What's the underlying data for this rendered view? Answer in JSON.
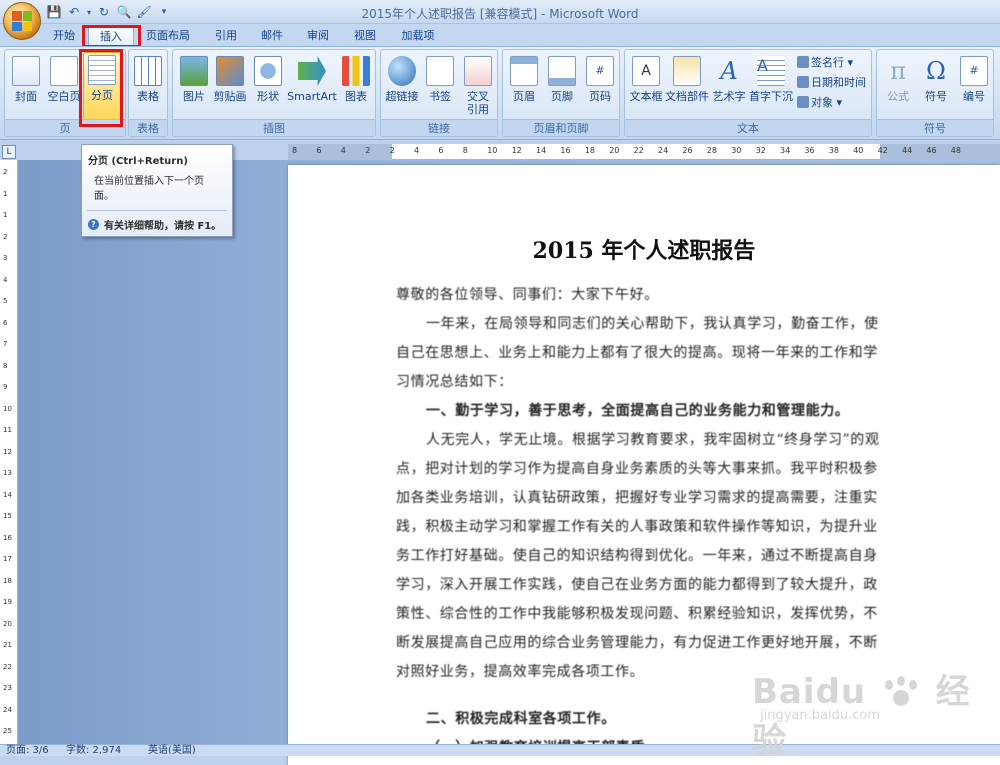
{
  "window": {
    "title": "2015年个人述职报告 [兼容模式] - Microsoft Word"
  },
  "tabs": [
    "开始",
    "插入",
    "页面布局",
    "引用",
    "邮件",
    "审阅",
    "视图",
    "加载项"
  ],
  "active_tab": "插入",
  "groups": {
    "page": {
      "label": "页",
      "buttons": [
        "封面",
        "空白页",
        "分页"
      ]
    },
    "table": {
      "label": "表格",
      "buttons": [
        "表格"
      ]
    },
    "illustrations": {
      "label": "插图",
      "buttons": [
        "图片",
        "剪贴画",
        "形状",
        "SmartArt",
        "图表"
      ]
    },
    "links": {
      "label": "链接",
      "buttons": [
        "超链接",
        "书签",
        "交叉引用"
      ]
    },
    "header_footer": {
      "label": "页眉和页脚",
      "buttons": [
        "页眉",
        "页脚",
        "页码"
      ]
    },
    "text": {
      "label": "文本",
      "buttons": [
        "文本框",
        "文档部件",
        "艺术字",
        "首字下沉"
      ],
      "small": [
        "签名行",
        "日期和时间",
        "对象"
      ]
    },
    "symbols": {
      "label": "符号",
      "buttons": [
        "公式",
        "符号",
        "编号"
      ]
    }
  },
  "tooltip": {
    "title": "分页 (Ctrl+Return)",
    "body": "在当前位置插入下一个页面。",
    "help": "有关详细帮助，请按 F1。"
  },
  "document": {
    "title": "2015 年个人述职报告",
    "paragraphs": [
      {
        "text": "尊敬的各位领导、同事们：大家下午好。",
        "bold": false,
        "indent": false
      },
      {
        "text": "一年来，在局领导和同志们的关心帮助下，我认真学习，勤奋工作，使自己在思想上、业务上和能力上都有了很大的提高。现将一年来的工作和学习情况总结如下：",
        "bold": false,
        "indent": true
      },
      {
        "text": "一、勤于学习，善于思考，全面提高自己的业务能力和管理能力。",
        "bold": true,
        "indent": true
      },
      {
        "text": "人无完人，学无止境。根据学习教育要求，我牢固树立“终身学习”的观点，把对计划的学习作为提高自身业务素质的头等大事来抓。我平时积极参加各类业务培训，认真钻研政策，把握好专业学习需求的提高需要，注重实践，积极主动学习和掌握工作有关的人事政策和软件操作等知识，为提升业务工作打好基础。使自己的知识结构得到优化。一年来，通过不断提高自身学习，深入开展工作实践，使自己在业务方面的能力都得到了较大提升，政策性、综合性的工作中我能够积极发现问题、积累经验知识，发挥优势，不断发展提高自己应用的综合业务管理能力，有力促进工作更好地开展，不断对照好业务，提高效率完成各项工作。",
        "bold": false,
        "indent": true
      },
      {
        "text": "二、积极完成科室各项工作。",
        "bold": true,
        "indent": true
      },
      {
        "text": "（一）加强教育培训提高干部素质",
        "bold": true,
        "indent": true
      }
    ]
  },
  "ruler_labels": [
    "8",
    "6",
    "4",
    "2",
    "2",
    "4",
    "6",
    "8",
    "10",
    "12",
    "14",
    "16",
    "18",
    "20",
    "22",
    "24",
    "26",
    "28",
    "30",
    "32",
    "34",
    "36",
    "38",
    "40",
    "42",
    "44",
    "46",
    "48"
  ],
  "ruler_v_labels": [
    "2",
    "1",
    "1",
    "2",
    "3",
    "4",
    "5",
    "6",
    "7",
    "8",
    "9",
    "10",
    "11",
    "12",
    "13",
    "14",
    "15",
    "16",
    "17",
    "18",
    "19",
    "20",
    "21",
    "22",
    "23",
    "24",
    "25"
  ],
  "status": {
    "page": "页面: 3/6",
    "words": "字数: 2,974",
    "lang": "英语(美国)"
  },
  "watermark": {
    "brand": "Baidu",
    "cn": "经验",
    "url": "jingyan.baidu.com"
  },
  "colors": {
    "accent": "#15428b",
    "highlight": "#e0161b",
    "button_active": "#ffd34d"
  }
}
